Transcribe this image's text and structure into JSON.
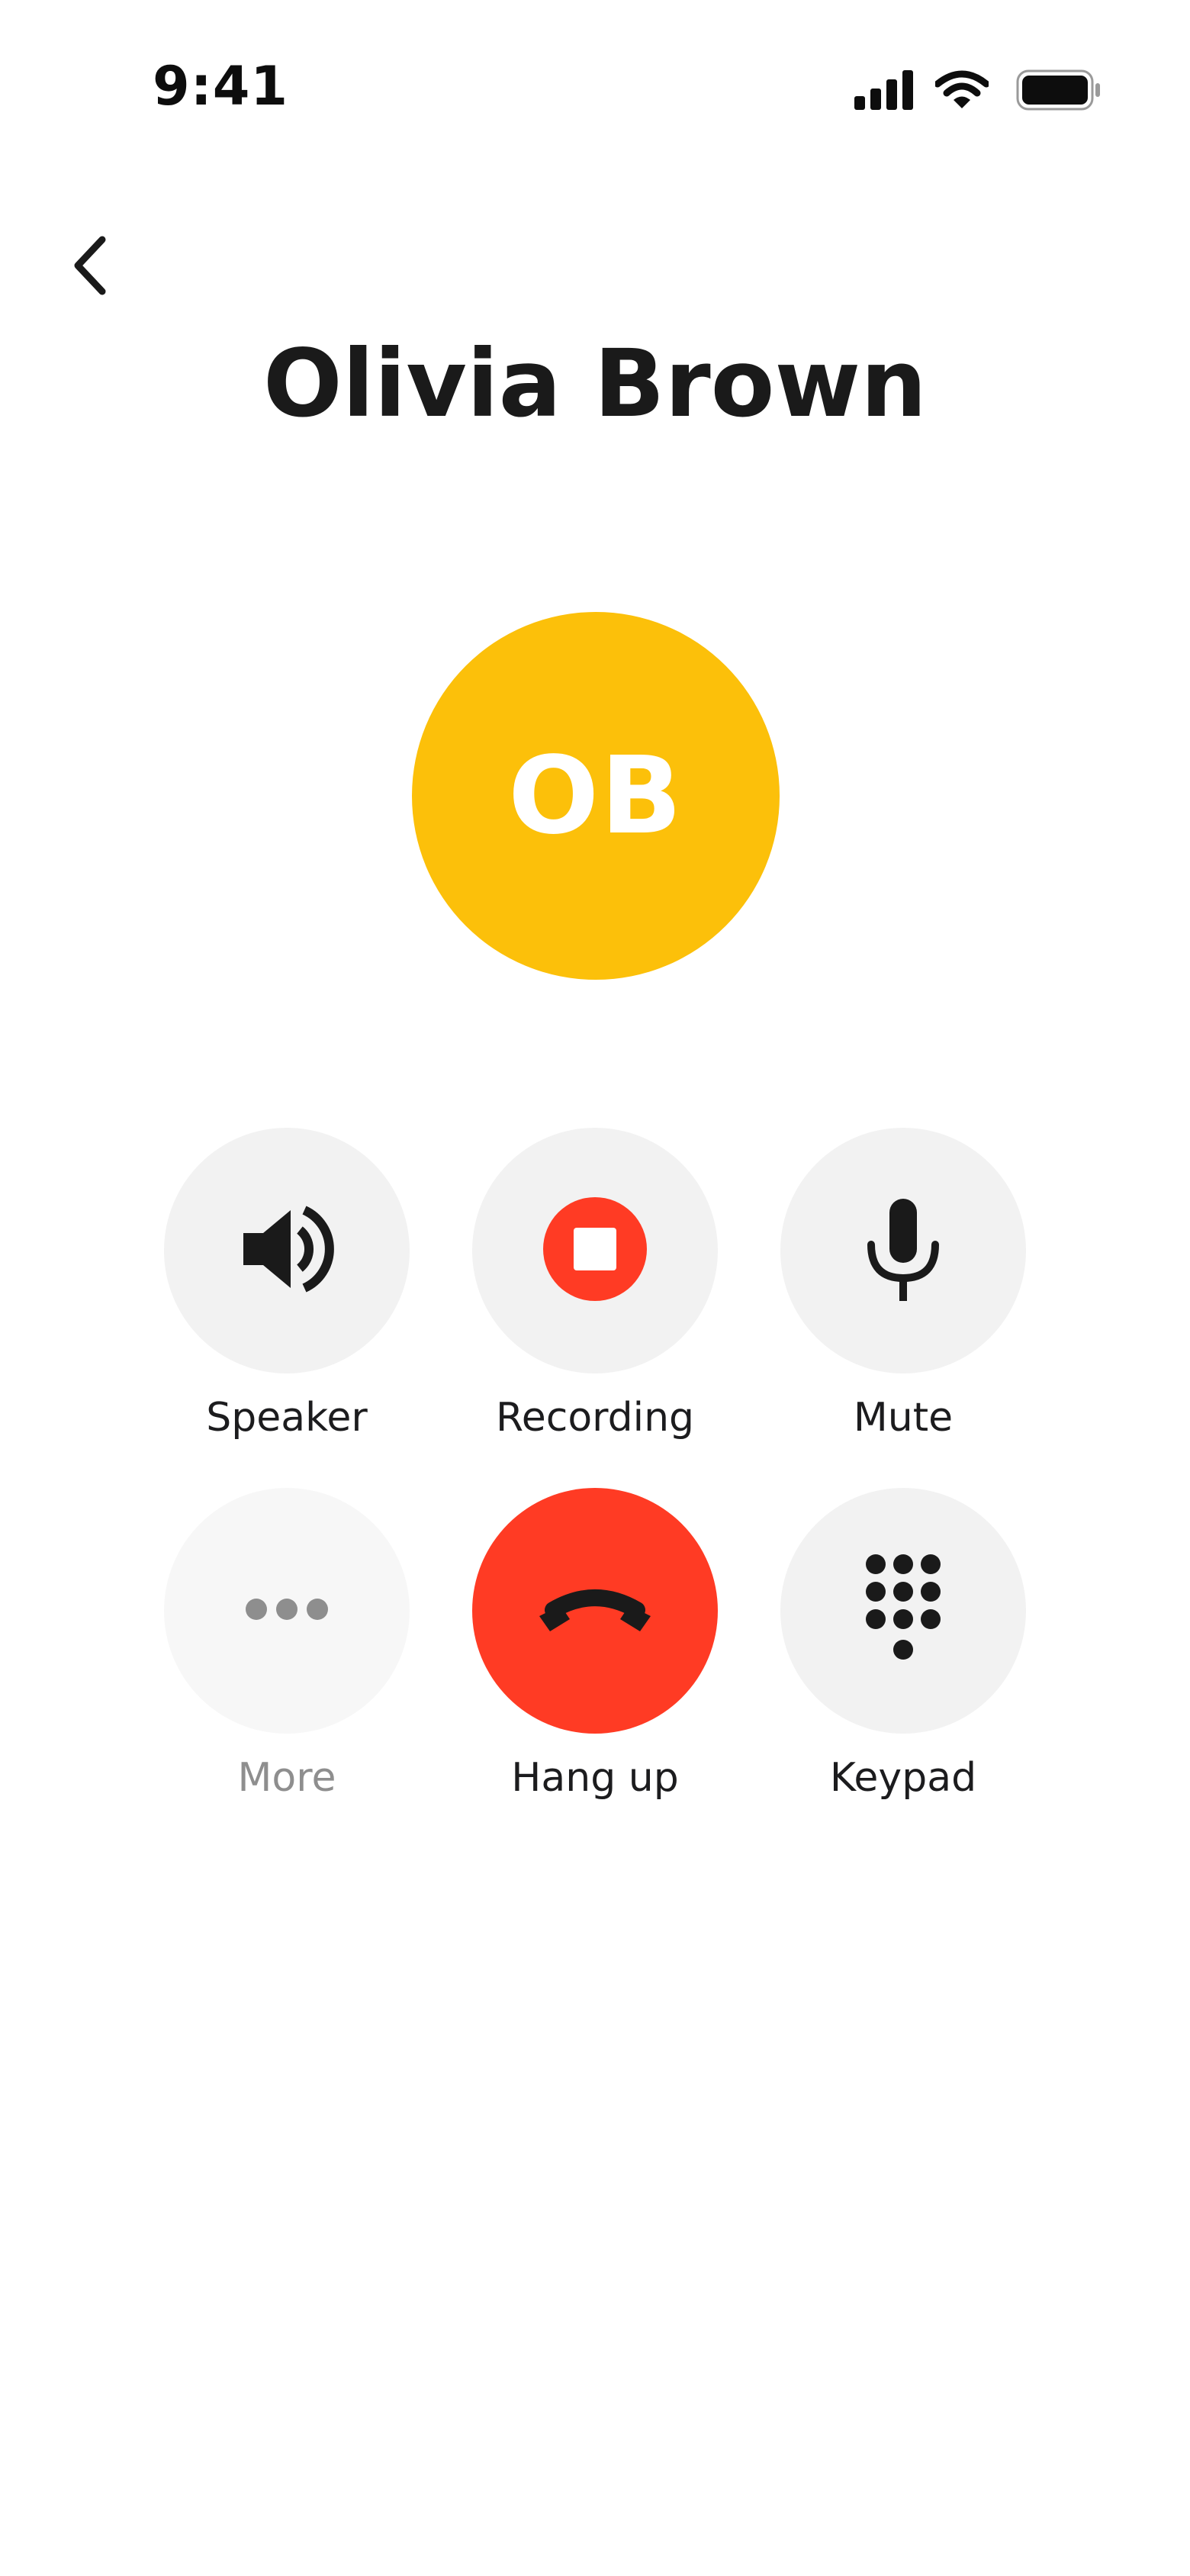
{
  "status_bar": {
    "time": "9:41",
    "icons": [
      "cellular-signal-icon",
      "wifi-icon",
      "battery-icon"
    ]
  },
  "header": {
    "back_icon": "chevron-left-icon",
    "contact_name": "Olivia Brown"
  },
  "avatar": {
    "initials": "OB",
    "color": "#FCC00A"
  },
  "controls": [
    {
      "label": "Speaker",
      "icon": "speaker-icon",
      "state": "normal"
    },
    {
      "label": "Recording",
      "icon": "stop-recording-icon",
      "state": "active",
      "accent": "#FF3B24"
    },
    {
      "label": "Mute",
      "icon": "microphone-icon",
      "state": "normal"
    },
    {
      "label": "More",
      "icon": "more-dots-icon",
      "state": "disabled"
    },
    {
      "label": "Hang up",
      "icon": "hang-up-phone-icon",
      "state": "danger",
      "accent": "#FF3B24"
    },
    {
      "label": "Keypad",
      "icon": "keypad-icon",
      "state": "normal"
    }
  ]
}
